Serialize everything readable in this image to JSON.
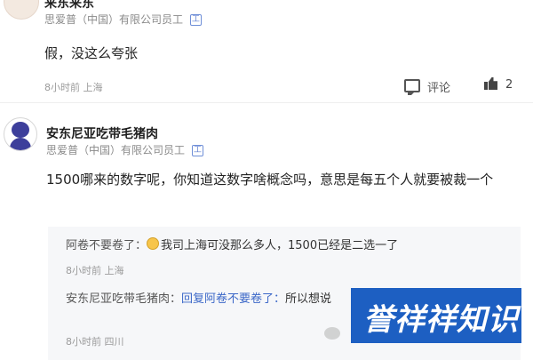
{
  "comments": [
    {
      "name": "来东来东",
      "company": "思爱普（中国）有限公司员工",
      "verify_badge": "工",
      "body": "假，没这么夸张",
      "meta": "8小时前 上海",
      "reply_label": "评论",
      "likes": "2"
    },
    {
      "name": "安东尼亚吃带毛猪肉",
      "company": "思爱普（中国）有限公司员工",
      "verify_badge": "工",
      "body": "1500哪来的数字呢，你知道这数字啥概念吗，意思是每五个人就要被裁一个"
    }
  ],
  "replies": [
    {
      "name": "阿卷不要卷了：",
      "text": "我司上海可没那么多人，1500已经是二选一了",
      "meta": "8小时前 上海"
    },
    {
      "name": "安东尼亚吃带毛猪肉：",
      "reply_to": "回复阿卷不要卷了：",
      "text": "所以想说",
      "meta": "8小时前 四川"
    }
  ],
  "watermark": {
    "text": "誉祥祥知识"
  },
  "icons": {
    "comment": "comment-icon",
    "like": "thumbs-up-icon",
    "emoji": "emoji-icon",
    "wechat": "wechat-icon"
  }
}
